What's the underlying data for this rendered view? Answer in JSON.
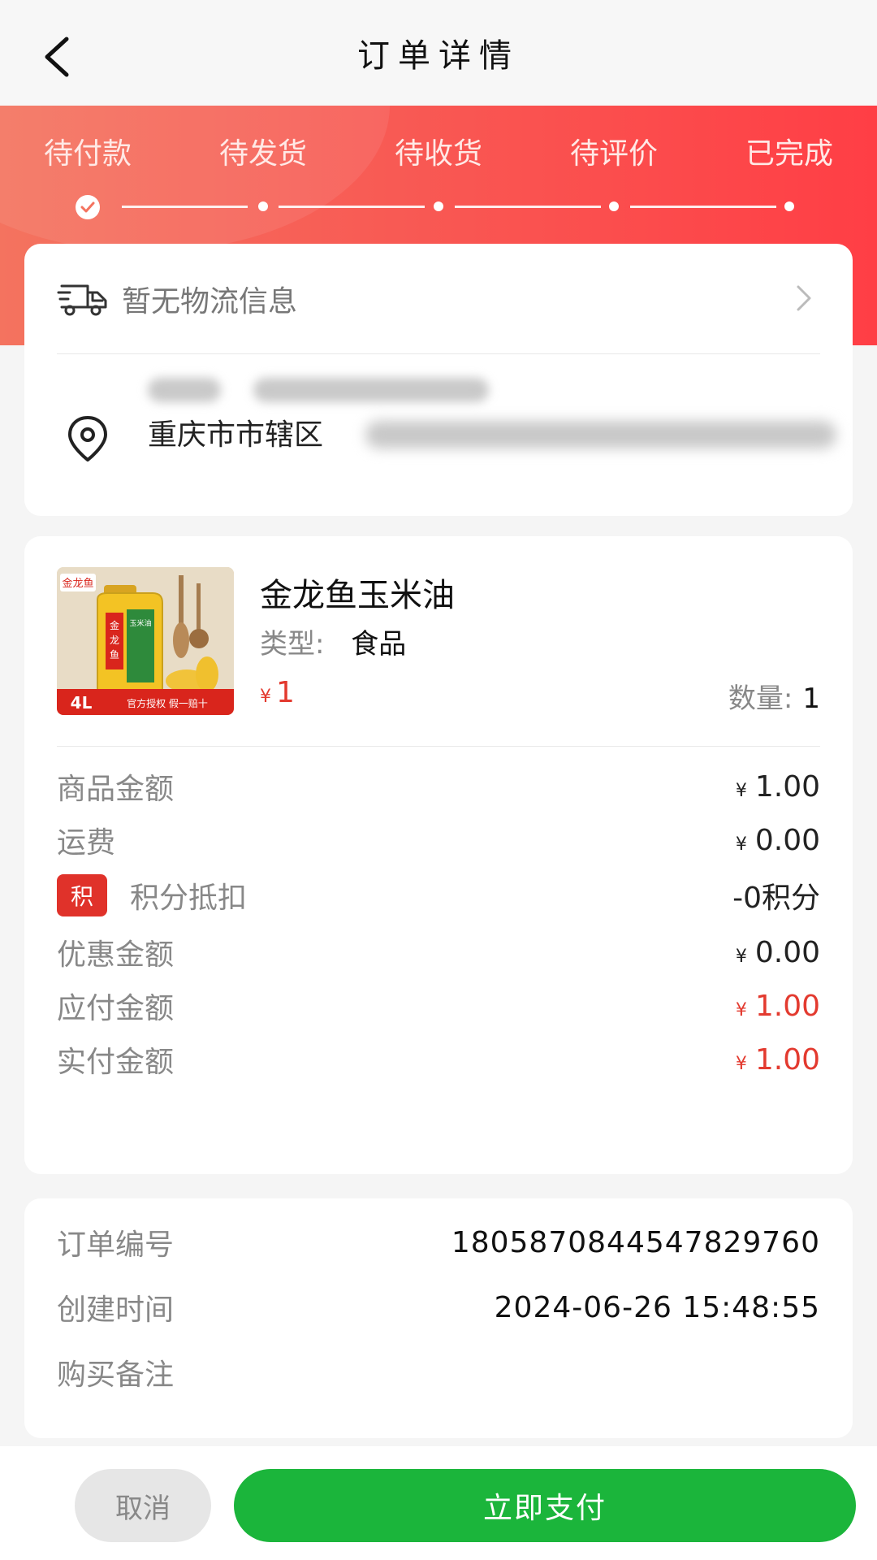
{
  "header": {
    "title": "订单详情",
    "back_icon": "chevron-left-icon"
  },
  "steps": [
    {
      "label": "待付款",
      "done": true
    },
    {
      "label": "待发货",
      "done": false
    },
    {
      "label": "待收货",
      "done": false
    },
    {
      "label": "待评价",
      "done": false
    },
    {
      "label": "已完成",
      "done": false
    }
  ],
  "logistics": {
    "text": "暂无物流信息",
    "icon": "truck-icon"
  },
  "address": {
    "visible_prefix": "重庆市市辖区",
    "icon": "location-pin-icon"
  },
  "product": {
    "name": "金龙鱼玉米油",
    "type_label": "类型:",
    "type_value": "食品",
    "price_currency": "¥",
    "price": "1",
    "qty_label": "数量:",
    "qty_value": "1",
    "image": {
      "brand": "金龙鱼",
      "volume": "4L",
      "badge": "官方授权  假一赔十",
      "bottle_label": "玉米油"
    }
  },
  "summary": {
    "goods_amount": {
      "label": "商品金额",
      "currency": "¥",
      "value": "1.00"
    },
    "shipping": {
      "label": "运费",
      "currency": "¥",
      "value": "0.00"
    },
    "points": {
      "badge": "积",
      "label": "积分抵扣",
      "value": "-0积分"
    },
    "discount": {
      "label": "优惠金额",
      "currency": "¥",
      "value": "0.00"
    },
    "payable": {
      "label": "应付金额",
      "currency": "¥",
      "value": "1.00"
    },
    "paid": {
      "label": "实付金额",
      "currency": "¥",
      "value": "1.00"
    }
  },
  "info": {
    "order_no": {
      "label": "订单编号",
      "value": "1805870844547829760"
    },
    "created": {
      "label": "创建时间",
      "value": "2024-06-26 15:48:55"
    },
    "remark": {
      "label": "购买备注",
      "value": ""
    }
  },
  "actions": {
    "cancel_label": "取消",
    "pay_label": "立即支付"
  },
  "colors": {
    "accent_red": "#e33a2f",
    "banner_red": "#ff4a4a",
    "pay_green": "#1bb53b"
  }
}
